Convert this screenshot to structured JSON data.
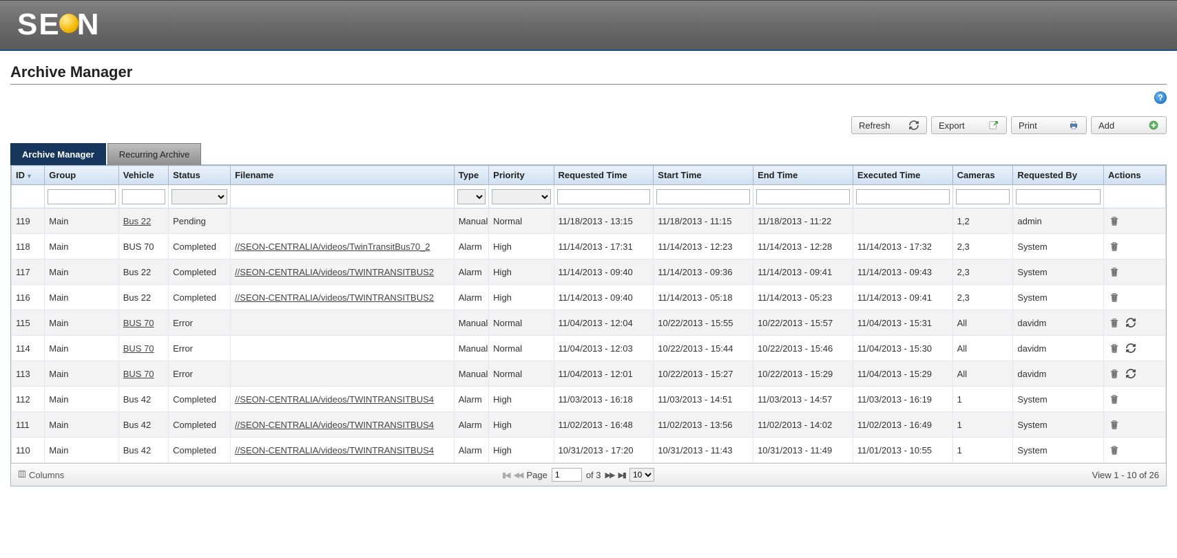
{
  "brand": "SEON",
  "page_title": "Archive Manager",
  "toolbar": {
    "refresh": "Refresh",
    "export": "Export",
    "print": "Print",
    "add": "Add"
  },
  "tabs": {
    "active": "Archive Manager",
    "inactive": "Recurring Archive"
  },
  "columns": {
    "id": "ID",
    "group": "Group",
    "vehicle": "Vehicle",
    "status": "Status",
    "filename": "Filename",
    "type": "Type",
    "priority": "Priority",
    "requested_time": "Requested Time",
    "start_time": "Start Time",
    "end_time": "End Time",
    "executed_time": "Executed Time",
    "cameras": "Cameras",
    "requested_by": "Requested By",
    "actions": "Actions"
  },
  "rows": [
    {
      "id": "119",
      "group": "Main",
      "vehicle": "Bus 22",
      "vehicle_link": true,
      "status": "Pending",
      "filename": "",
      "filename_link": false,
      "type": "Manual",
      "priority": "Normal",
      "requested": "11/18/2013 - 13:15",
      "start": "11/18/2013 - 11:15",
      "end": "11/18/2013 - 11:22",
      "executed": "",
      "cameras": "1,2",
      "by": "admin",
      "retry": false
    },
    {
      "id": "118",
      "group": "Main",
      "vehicle": "BUS 70",
      "vehicle_link": false,
      "status": "Completed",
      "filename": "//SEON-CENTRALIA/videos/TwinTransitBus70_2",
      "filename_link": true,
      "type": "Alarm",
      "priority": "High",
      "requested": "11/14/2013 - 17:31",
      "start": "11/14/2013 - 12:23",
      "end": "11/14/2013 - 12:28",
      "executed": "11/14/2013 - 17:32",
      "cameras": "2,3",
      "by": "System",
      "retry": false
    },
    {
      "id": "117",
      "group": "Main",
      "vehicle": "Bus 22",
      "vehicle_link": false,
      "status": "Completed",
      "filename": "//SEON-CENTRALIA/videos/TWINTRANSITBUS2",
      "filename_link": true,
      "type": "Alarm",
      "priority": "High",
      "requested": "11/14/2013 - 09:40",
      "start": "11/14/2013 - 09:36",
      "end": "11/14/2013 - 09:41",
      "executed": "11/14/2013 - 09:43",
      "cameras": "2,3",
      "by": "System",
      "retry": false
    },
    {
      "id": "116",
      "group": "Main",
      "vehicle": "Bus 22",
      "vehicle_link": false,
      "status": "Completed",
      "filename": "//SEON-CENTRALIA/videos/TWINTRANSITBUS2",
      "filename_link": true,
      "type": "Alarm",
      "priority": "High",
      "requested": "11/14/2013 - 09:40",
      "start": "11/14/2013 - 05:18",
      "end": "11/14/2013 - 05:23",
      "executed": "11/14/2013 - 09:41",
      "cameras": "2,3",
      "by": "System",
      "retry": false
    },
    {
      "id": "115",
      "group": "Main",
      "vehicle": "BUS 70",
      "vehicle_link": true,
      "status": "Error",
      "filename": "",
      "filename_link": false,
      "type": "Manual",
      "priority": "Normal",
      "requested": "11/04/2013 - 12:04",
      "start": "10/22/2013 - 15:55",
      "end": "10/22/2013 - 15:57",
      "executed": "11/04/2013 - 15:31",
      "cameras": "All",
      "by": "davidm",
      "retry": true
    },
    {
      "id": "114",
      "group": "Main",
      "vehicle": "BUS 70",
      "vehicle_link": true,
      "status": "Error",
      "filename": "",
      "filename_link": false,
      "type": "Manual",
      "priority": "Normal",
      "requested": "11/04/2013 - 12:03",
      "start": "10/22/2013 - 15:44",
      "end": "10/22/2013 - 15:46",
      "executed": "11/04/2013 - 15:30",
      "cameras": "All",
      "by": "davidm",
      "retry": true
    },
    {
      "id": "113",
      "group": "Main",
      "vehicle": "BUS 70",
      "vehicle_link": true,
      "status": "Error",
      "filename": "",
      "filename_link": false,
      "type": "Manual",
      "priority": "Normal",
      "requested": "11/04/2013 - 12:01",
      "start": "10/22/2013 - 15:27",
      "end": "10/22/2013 - 15:29",
      "executed": "11/04/2013 - 15:29",
      "cameras": "All",
      "by": "davidm",
      "retry": true
    },
    {
      "id": "112",
      "group": "Main",
      "vehicle": "Bus 42",
      "vehicle_link": false,
      "status": "Completed",
      "filename": "//SEON-CENTRALIA/videos/TWINTRANSITBUS4",
      "filename_link": true,
      "type": "Alarm",
      "priority": "High",
      "requested": "11/03/2013 - 16:18",
      "start": "11/03/2013 - 14:51",
      "end": "11/03/2013 - 14:57",
      "executed": "11/03/2013 - 16:19",
      "cameras": "1",
      "by": "System",
      "retry": false
    },
    {
      "id": "111",
      "group": "Main",
      "vehicle": "Bus 42",
      "vehicle_link": false,
      "status": "Completed",
      "filename": "//SEON-CENTRALIA/videos/TWINTRANSITBUS4",
      "filename_link": true,
      "type": "Alarm",
      "priority": "High",
      "requested": "11/02/2013 - 16:48",
      "start": "11/02/2013 - 13:56",
      "end": "11/02/2013 - 14:02",
      "executed": "11/02/2013 - 16:49",
      "cameras": "1",
      "by": "System",
      "retry": false
    },
    {
      "id": "110",
      "group": "Main",
      "vehicle": "Bus 42",
      "vehicle_link": false,
      "status": "Completed",
      "filename": "//SEON-CENTRALIA/videos/TWINTRANSITBUS4",
      "filename_link": true,
      "type": "Alarm",
      "priority": "High",
      "requested": "10/31/2013 - 17:20",
      "start": "10/31/2013 - 11:43",
      "end": "10/31/2013 - 11:49",
      "executed": "11/01/2013 - 10:55",
      "cameras": "1",
      "by": "System",
      "retry": false
    }
  ],
  "footer": {
    "columns_label": "Columns",
    "page_label": "Page",
    "page_current": "1",
    "page_total_label": "of 3",
    "page_size": "10",
    "view_label": "View 1 - 10 of 26"
  }
}
